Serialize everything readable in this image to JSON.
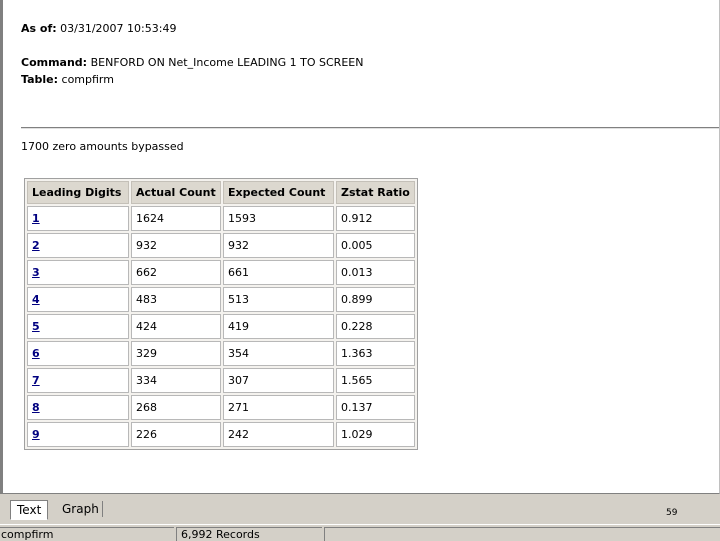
{
  "report": {
    "as_of_label": "As of:",
    "as_of_value": "03/31/2007 10:53:49",
    "command_label": "Command:",
    "command_value": "BENFORD ON Net_Income LEADING 1 TO SCREEN",
    "table_label": "Table:",
    "table_value": "compfirm",
    "note": "1700 zero amounts bypassed"
  },
  "results": {
    "headers": [
      "Leading Digits",
      "Actual Count",
      "Expected Count",
      "Zstat Ratio"
    ],
    "rows": [
      {
        "digit": "1",
        "actual": "1624",
        "expected": "1593",
        "zstat": "0.912"
      },
      {
        "digit": "2",
        "actual": "932",
        "expected": "932",
        "zstat": "0.005"
      },
      {
        "digit": "3",
        "actual": "662",
        "expected": "661",
        "zstat": "0.013"
      },
      {
        "digit": "4",
        "actual": "483",
        "expected": "513",
        "zstat": "0.899"
      },
      {
        "digit": "5",
        "actual": "424",
        "expected": "419",
        "zstat": "0.228"
      },
      {
        "digit": "6",
        "actual": "329",
        "expected": "354",
        "zstat": "1.363"
      },
      {
        "digit": "7",
        "actual": "334",
        "expected": "307",
        "zstat": "1.565"
      },
      {
        "digit": "8",
        "actual": "268",
        "expected": "271",
        "zstat": "0.137"
      },
      {
        "digit": "9",
        "actual": "226",
        "expected": "242",
        "zstat": "1.029"
      }
    ]
  },
  "tabs": [
    {
      "label": "Text",
      "active": true
    },
    {
      "label": "Graph",
      "active": false
    }
  ],
  "page_number": "59",
  "statusbar": {
    "table_name": "compfirm",
    "records": "6,992 Records"
  }
}
